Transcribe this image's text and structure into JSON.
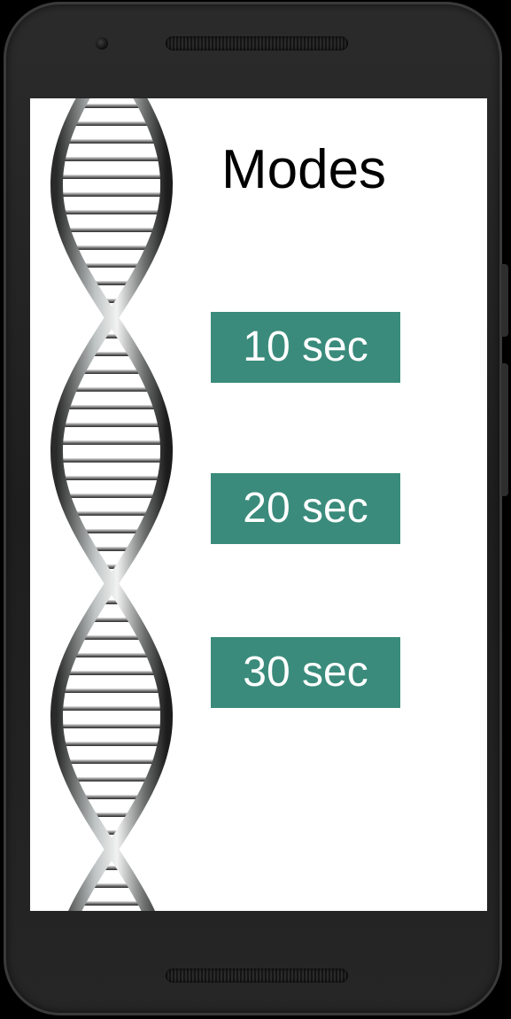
{
  "screen": {
    "title": "Modes",
    "buttons": [
      {
        "label": "10 sec"
      },
      {
        "label": "20 sec"
      },
      {
        "label": "30 sec"
      }
    ]
  },
  "colors": {
    "button_bg": "#3a8b7b",
    "button_text": "#ffffff",
    "screen_bg": "#ffffff",
    "phone_body": "#222222"
  },
  "icons": {
    "decoration": "dna-helix-image"
  }
}
